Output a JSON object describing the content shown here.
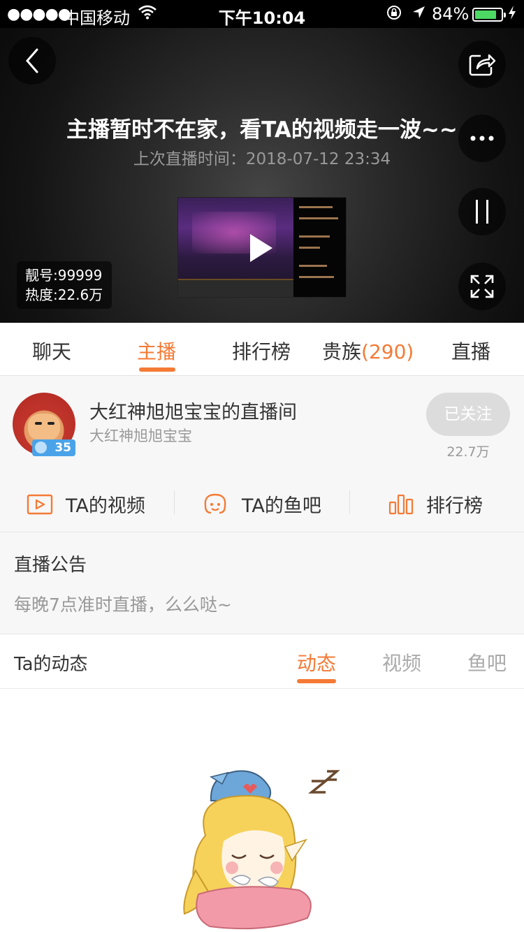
{
  "status_bar": {
    "signal": "●●●●●",
    "carrier": "中国移动",
    "time": "下午10:04",
    "battery_text": "84%",
    "battery_level": 0.84
  },
  "player": {
    "title": "主播暂时不在家，看TA的视频走一波~~",
    "last_live": "上次直播时间：2018-07-12 23:34",
    "room_number": "靓号:99999",
    "heat": "热度:22.6万"
  },
  "tabs": [
    {
      "label": "聊天"
    },
    {
      "label": "主播"
    },
    {
      "label": "排行榜"
    },
    {
      "label": "贵族",
      "count": "(290)"
    },
    {
      "label": "直播"
    }
  ],
  "anchor": {
    "room_title": "大红神旭旭宝宝的直播间",
    "name": "大红神旭旭宝宝",
    "level": "35",
    "follow_label": "已关注",
    "follow_count": "22.7万",
    "links": [
      {
        "label": "TA的视频",
        "icon": "video-icon"
      },
      {
        "label": "TA的鱼吧",
        "icon": "fishbar-icon"
      },
      {
        "label": "排行榜",
        "icon": "ranking-icon"
      }
    ]
  },
  "notice": {
    "title": "直播公告",
    "text": "每晚7点准时直播，么么哒~"
  },
  "dynamics": {
    "title": "Ta的动态",
    "tabs": [
      "动态",
      "视频",
      "鱼吧"
    ]
  },
  "colors": {
    "accent": "#f47a35",
    "battery": "#4cd964",
    "badge": "#4aa3e8"
  }
}
